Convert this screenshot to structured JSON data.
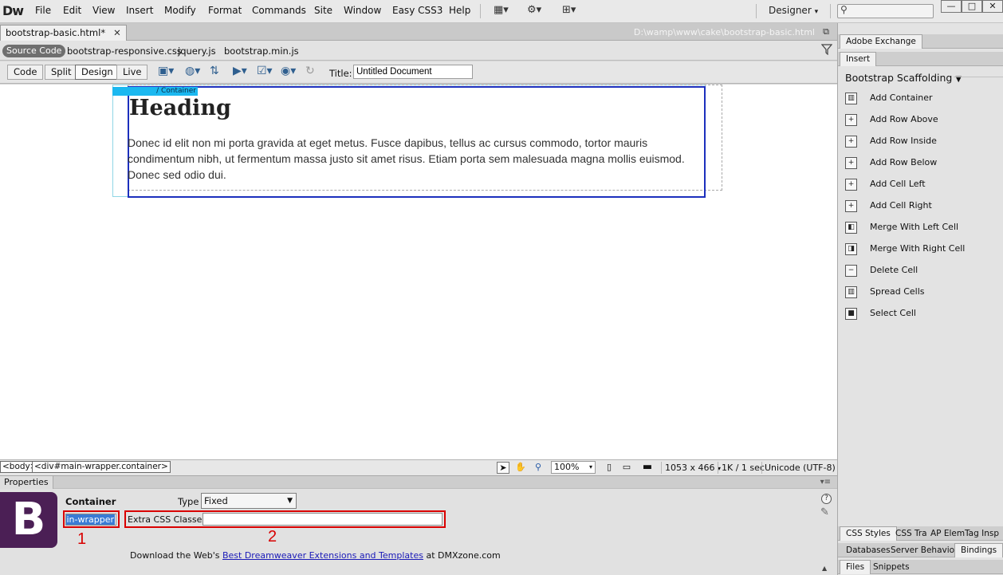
{
  "app": {
    "logo": "Dw",
    "menu": [
      "File",
      "Edit",
      "View",
      "Insert",
      "Modify",
      "Format",
      "Commands",
      "Site",
      "Window",
      "Easy CSS3",
      "Help"
    ],
    "workspace": "Designer",
    "window_buttons": [
      "—",
      "□",
      "✕"
    ]
  },
  "document": {
    "tab": "bootstrap-basic.html*",
    "path": "D:\\wamp\\www\\cake\\bootstrap-basic.html",
    "related_files": [
      "Source Code",
      "bootstrap-responsive.css",
      "jquery.js",
      "bootstrap.min.js"
    ],
    "view_buttons": [
      "Code",
      "Split",
      "Design",
      "Live"
    ],
    "active_view": "Design",
    "title_label": "Title:",
    "title_value": "Untitled Document"
  },
  "design_view": {
    "container_label": "/ Container",
    "heading": "Heading",
    "paragraph": "Donec id elit non mi porta gravida at eget metus. Fusce dapibus, tellus ac cursus commodo, tortor mauris condimentum nibh, ut fermentum massa justo sit amet risus. Etiam porta sem malesuada magna mollis euismod. Donec sed odio dui."
  },
  "status_bar": {
    "tags": [
      "<body>",
      "<div#main-wrapper.container>"
    ],
    "zoom": "100%",
    "size": "1053 x 466",
    "download": "1K / 1 sec",
    "encoding": "Unicode (UTF-8)"
  },
  "properties": {
    "tab": "Properties",
    "component": "Container",
    "logo_letter": "B",
    "type_label": "Type",
    "type_value": "Fixed",
    "id_value": "main-wrapper",
    "extra_css_label": "Extra CSS Classes",
    "extra_css_value": "",
    "annotation_1": "1",
    "annotation_2": "2",
    "promo_prefix": "Download the Web's ",
    "promo_link": "Best Dreamweaver Extensions and Templates",
    "promo_suffix": " at DMXzone.com"
  },
  "right_panel": {
    "exchange_tab": "Adobe Exchange",
    "insert_tab": "Insert",
    "category": "Bootstrap Scaffolding",
    "items": [
      {
        "label": "Add Container",
        "glyph": "▥"
      },
      {
        "label": "Add Row Above",
        "glyph": "+"
      },
      {
        "label": "Add Row Inside",
        "glyph": "+"
      },
      {
        "label": "Add Row Below",
        "glyph": "+"
      },
      {
        "label": "Add Cell Left",
        "glyph": "+"
      },
      {
        "label": "Add Cell Right",
        "glyph": "+"
      },
      {
        "label": "Merge With Left Cell",
        "glyph": "◧"
      },
      {
        "label": "Merge With Right Cell",
        "glyph": "◨"
      },
      {
        "label": "Delete Cell",
        "glyph": "−"
      },
      {
        "label": "Spread Cells",
        "glyph": "▥"
      },
      {
        "label": "Select Cell",
        "glyph": "■"
      }
    ],
    "bottom_tabs_1": [
      "CSS Styles",
      "CSS Tra",
      "AP Elem",
      "Tag Insp"
    ],
    "bottom_tabs_2": [
      "Databases",
      "Server Behaviors",
      "Bindings"
    ],
    "bottom_tabs_3": [
      "Files",
      "Snippets"
    ]
  }
}
